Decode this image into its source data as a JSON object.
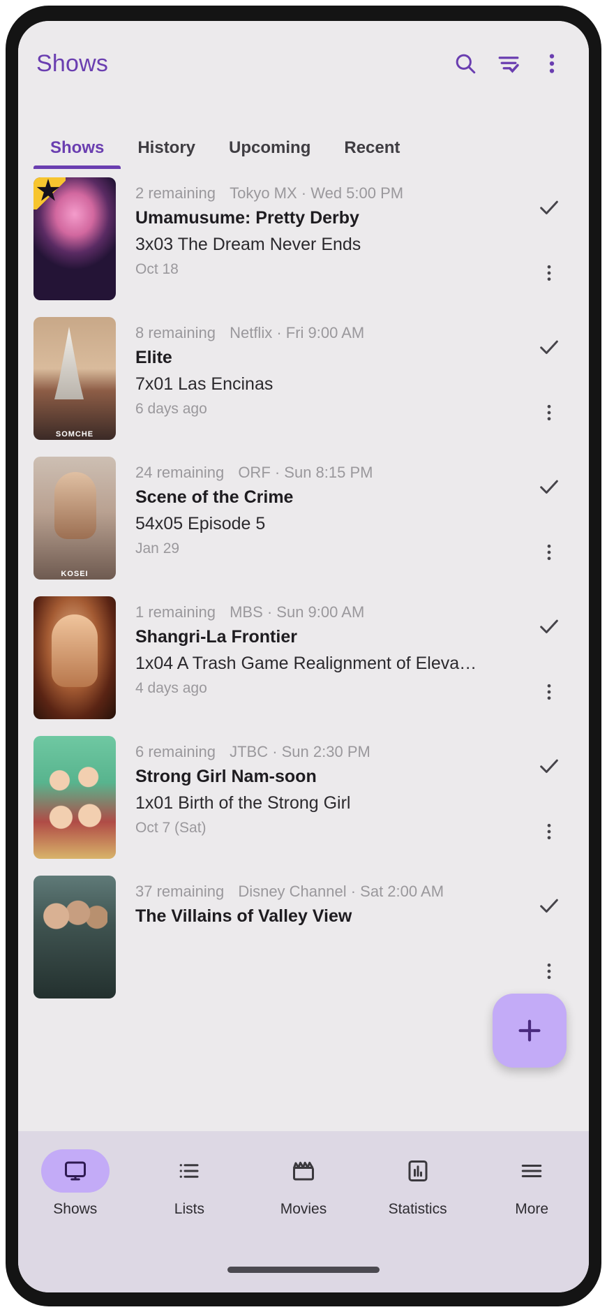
{
  "app": {
    "title": "Shows",
    "accent_color": "#6a3eb0",
    "fab_accent": "#c3abf7",
    "screen_bg": "#eceaec",
    "nav_bg": "#ddd8e4"
  },
  "appbar": {
    "search_icon": "search-icon",
    "filter_icon": "filter-check-icon",
    "overflow_icon": "more-vertical-icon"
  },
  "tabs": [
    {
      "label": "Shows",
      "active": true
    },
    {
      "label": "History",
      "active": false
    },
    {
      "label": "Upcoming",
      "active": false
    },
    {
      "label": "Recent",
      "active": false
    }
  ],
  "shows": [
    {
      "remaining": "2 remaining",
      "network_time": "Tokyo MX · Wed 5:00 PM",
      "title": "Umamusume: Pretty Derby",
      "episode": "3x03 The Dream Never Ends",
      "date": "Oct 18",
      "poster_badge": ""
    },
    {
      "remaining": "8 remaining",
      "network_time": "Netflix · Fri 9:00 AM",
      "title": "Elite",
      "episode": "7x01 Las Encinas",
      "date": "6 days ago",
      "poster_badge": "SOMCHE"
    },
    {
      "remaining": "24 remaining",
      "network_time": "ORF · Sun 8:15 PM",
      "title": "Scene of the Crime",
      "episode": "54x05 Episode 5",
      "date": "Jan 29",
      "poster_badge": "KOSEI"
    },
    {
      "remaining": "1 remaining",
      "network_time": "MBS · Sun 9:00 AM",
      "title": "Shangri-La Frontier",
      "episode": "1x04 A Trash Game Realignment of Eleva…",
      "date": "4 days ago",
      "poster_badge": ""
    },
    {
      "remaining": "6 remaining",
      "network_time": "JTBC · Sun 2:30 PM",
      "title": "Strong Girl Nam-soon",
      "episode": "1x01 Birth of the Strong Girl",
      "date": "Oct 7 (Sat)",
      "poster_badge": ""
    },
    {
      "remaining": "37 remaining",
      "network_time": "Disney Channel · Sat 2:00 AM",
      "title": "The Villains of Valley View",
      "episode": "",
      "date": "",
      "poster_badge": ""
    }
  ],
  "row_actions": {
    "check_icon": "check-icon",
    "more_icon": "more-vertical-icon"
  },
  "fab": {
    "label": "+",
    "icon": "plus-icon"
  },
  "bottom_nav": [
    {
      "label": "Shows",
      "icon": "tv-icon",
      "active": true
    },
    {
      "label": "Lists",
      "icon": "list-icon",
      "active": false
    },
    {
      "label": "Movies",
      "icon": "clapperboard-icon",
      "active": false
    },
    {
      "label": "Statistics",
      "icon": "bar-chart-icon",
      "active": false
    },
    {
      "label": "More",
      "icon": "hamburger-icon",
      "active": false
    }
  ]
}
